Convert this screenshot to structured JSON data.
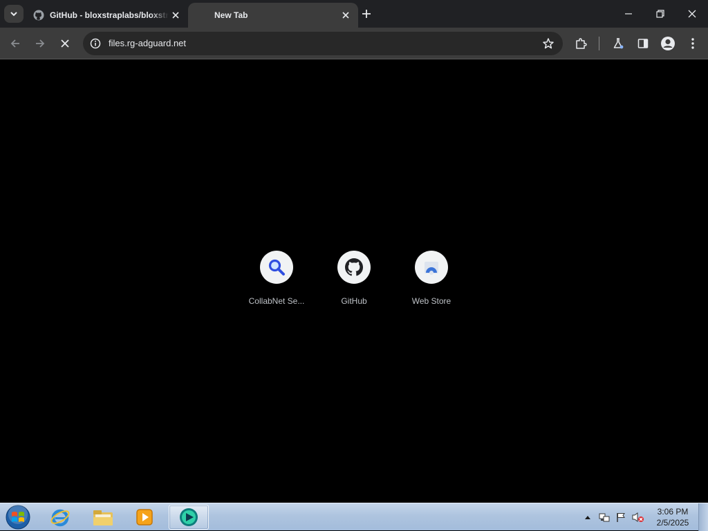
{
  "tabs": [
    {
      "title": "GitHub - bloxstraplabs/bloxstrap",
      "active": false,
      "favicon": "github-icon"
    },
    {
      "title": "New Tab",
      "active": true,
      "favicon": ""
    }
  ],
  "toolbar": {
    "url": "files.rg-adguard.net",
    "loading": true
  },
  "shortcuts": [
    {
      "label": "CollabNet Se...",
      "icon": "search-magnifier-icon"
    },
    {
      "label": "GitHub",
      "icon": "github-icon"
    },
    {
      "label": "Web Store",
      "icon": "web-store-icon"
    }
  ],
  "taskbar": {
    "apps": [
      "internet-explorer-icon",
      "file-explorer-icon",
      "media-player-icon",
      "chrome-app-icon"
    ],
    "clock": {
      "time": "3:06 PM",
      "date": "2/5/2025"
    }
  },
  "colors": {
    "tab_strip": "#202124",
    "toolbar": "#3c3c3c",
    "omnibox": "#282828",
    "content_bg": "#000000",
    "tile_circle": "#f1f3f4",
    "tile_label": "#bdc1c6"
  }
}
